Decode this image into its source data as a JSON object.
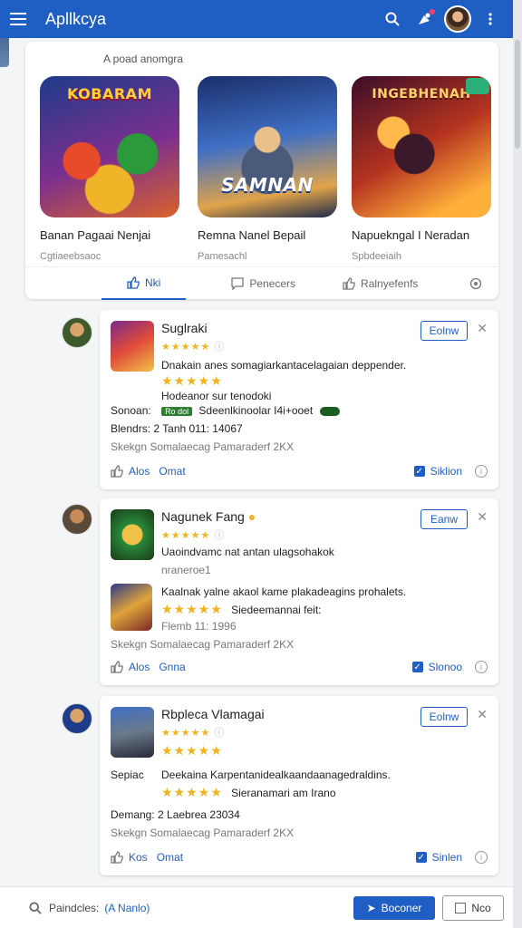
{
  "appbar": {
    "title": "Apllkcya"
  },
  "featured": {
    "subhead": "A poad anomgra",
    "games": [
      {
        "name": "Banan Pagaai Nenjai",
        "category": "Cgtiaeebsaoc",
        "art_text": "KOBARAM"
      },
      {
        "name": "Remna Nanel Bepail",
        "category": "Pamesachl",
        "art_text": "SAMNAN"
      },
      {
        "name": "Napuekngal I Neradan",
        "category": "Spbdeeiaih",
        "art_text": "INGEBHENAH"
      }
    ]
  },
  "tabs": [
    {
      "label": "Nki"
    },
    {
      "label": "Penecers"
    },
    {
      "label": "Ralnyefenfs"
    }
  ],
  "reviews": [
    {
      "name": "Suglraki",
      "stars": "★★★★★",
      "follow": "Eolnw",
      "comment": "Dnakain anes somagiarkantacelagaian deppender.",
      "big_stars": "★★★★★",
      "line2": "Hodeanor sur tenodoki",
      "line3_label": "Sonoan:",
      "line3_pill": "Ro dol",
      "line3_text": "Sdeenlkinoolar I4i+ooet",
      "line4": "Blendrs:  2 Tanh 011: 14067",
      "line5": "Skekgn  Somalaecag Pamaraderf 2KX",
      "like": "Alos",
      "like_text": "Omat",
      "action": "Siklion"
    },
    {
      "name": "Nagunek Fang",
      "stars": "★★★★★",
      "follow": "Eanw",
      "comment": "Uaoindvamc nat antan ulagsohakok",
      "sub": "nraneroe1",
      "comment2": "Kaalnak yalne akaol kame plakadeagins prohalets.",
      "big_stars": "★★★★★",
      "big_stars_text": "Siedeemannai feit:",
      "line4": "Flemb 11: 1996",
      "line5": "Skekgn  Somalaecag Pamaraderf 2KX",
      "like": "Alos",
      "like_text": "Gnna",
      "action": "Slonoo"
    },
    {
      "name": "Rbpleca Vlamagai",
      "stars": "★★★★★",
      "follow": "Eolnw",
      "big_stars": "★★★★★",
      "line3_label": "Sepiac",
      "comment": "Deekaina Karpentanidealkaandaanagedraldins.",
      "big_stars2": "★★★★★",
      "big_stars2_text": "Sieranamari am Irano",
      "line4": "Demang:  2 Laebrea 23034",
      "line5": "Skekgn  Somalaecag Pamaraderf 2KX",
      "like": "Kos",
      "like_text": "Omat",
      "action": "Sinlen"
    }
  ],
  "bottombar": {
    "search_label": "Paindcles:",
    "search_placeholder": "(A Nanlo)",
    "primary": "Boconer",
    "secondary": "Nco"
  },
  "colors": {
    "accent": "#1f5fc4",
    "star": "#f2b31c"
  }
}
